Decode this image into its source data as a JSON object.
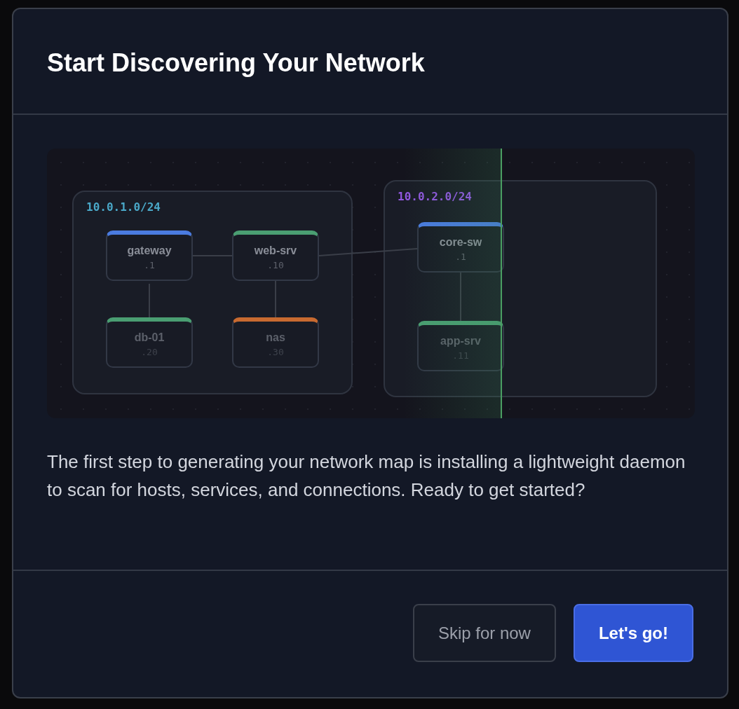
{
  "dialog": {
    "title": "Start Discovering Your Network",
    "diagram": {
      "subnets": [
        {
          "label": "10.0.1.0/24",
          "color": "#4aa8c8",
          "nodes": [
            {
              "name": "gateway",
              "address": ".1",
              "color": "#4a7be0",
              "discovered": true
            },
            {
              "name": "web-srv",
              "address": ".10",
              "color": "#4a9e72",
              "discovered": true
            },
            {
              "name": "db-01",
              "address": ".20",
              "color": "#4a9e72",
              "discovered": false
            },
            {
              "name": "nas",
              "address": ".30",
              "color": "#c86a30",
              "discovered": false
            }
          ]
        },
        {
          "label": "10.0.2.0/24",
          "color": "#9157e0",
          "nodes": [
            {
              "name": "core-sw",
              "address": ".1",
              "color": "#4a7be0",
              "discovered": true
            },
            {
              "name": "app-srv",
              "address": ".11",
              "color": "#4a9e72",
              "discovered": false
            }
          ]
        }
      ]
    },
    "description": "The first step to generating your network map is installing a lightweight daemon to scan for hosts, services, and connections. Ready to get started?",
    "buttons": [
      {
        "label": "Skip for now",
        "kind": "secondary"
      },
      {
        "label": "Let's go!",
        "kind": "primary"
      }
    ]
  }
}
